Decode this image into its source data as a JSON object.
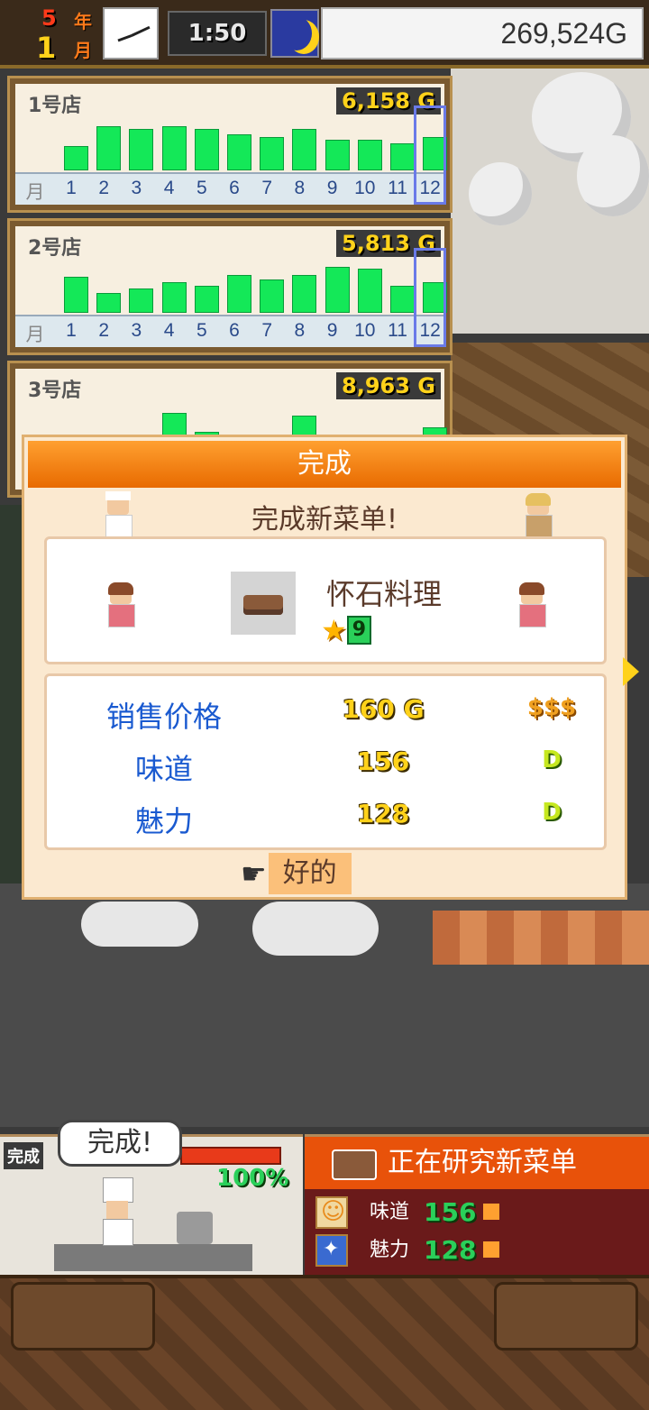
{
  "top_bar": {
    "year": "5",
    "year_unit": "年",
    "month": "1",
    "month_unit": "月",
    "time": "1:50",
    "money": "269,524G"
  },
  "stores": [
    {
      "name": "1号店",
      "sales": "6,158 G",
      "month_label": "月",
      "months": [
        "1",
        "2",
        "3",
        "4",
        "5",
        "6",
        "7",
        "8",
        "9",
        "10",
        "11",
        "12"
      ],
      "monthly_sales_relative": [
        0.52,
        0.94,
        0.89,
        0.94,
        0.89,
        0.76,
        0.71,
        0.89,
        0.66,
        0.66,
        0.58,
        0.71
      ],
      "highlighted_month": "12"
    },
    {
      "name": "2号店",
      "sales": "5,813 G",
      "month_label": "月",
      "months": [
        "1",
        "2",
        "3",
        "4",
        "5",
        "6",
        "7",
        "8",
        "9",
        "10",
        "11",
        "12"
      ],
      "monthly_sales_relative": [
        0.76,
        0.42,
        0.52,
        0.66,
        0.58,
        0.81,
        0.71,
        0.81,
        0.98,
        0.94,
        0.58,
        0.66
      ],
      "highlighted_month": "12"
    },
    {
      "name": "3号店",
      "sales": "8,963 G",
      "monthly_sales_relative": [
        0.15,
        0.25,
        0.1,
        0.9,
        0.5,
        0.1,
        0.1,
        0.85,
        0.45,
        0.35,
        0.1,
        0.6
      ]
    }
  ],
  "dialog": {
    "title": "完成",
    "subtitle": "完成新菜单!",
    "dish_name": "怀石料理",
    "rank": "9",
    "stats": [
      {
        "label": "销售价格",
        "value": "160 G",
        "badge": "$$$"
      },
      {
        "label": "味道",
        "value": "156",
        "badge": "D"
      },
      {
        "label": "魅力",
        "value": "128",
        "badge": "D"
      }
    ],
    "ok_label": "好的"
  },
  "research": {
    "done_tag": "完成",
    "bubble": "完成!",
    "progress_percent": "100%",
    "title": "正在研究新菜单",
    "rows": [
      {
        "label": "味道",
        "value": "156"
      },
      {
        "label": "魅力",
        "value": "128"
      }
    ]
  }
}
